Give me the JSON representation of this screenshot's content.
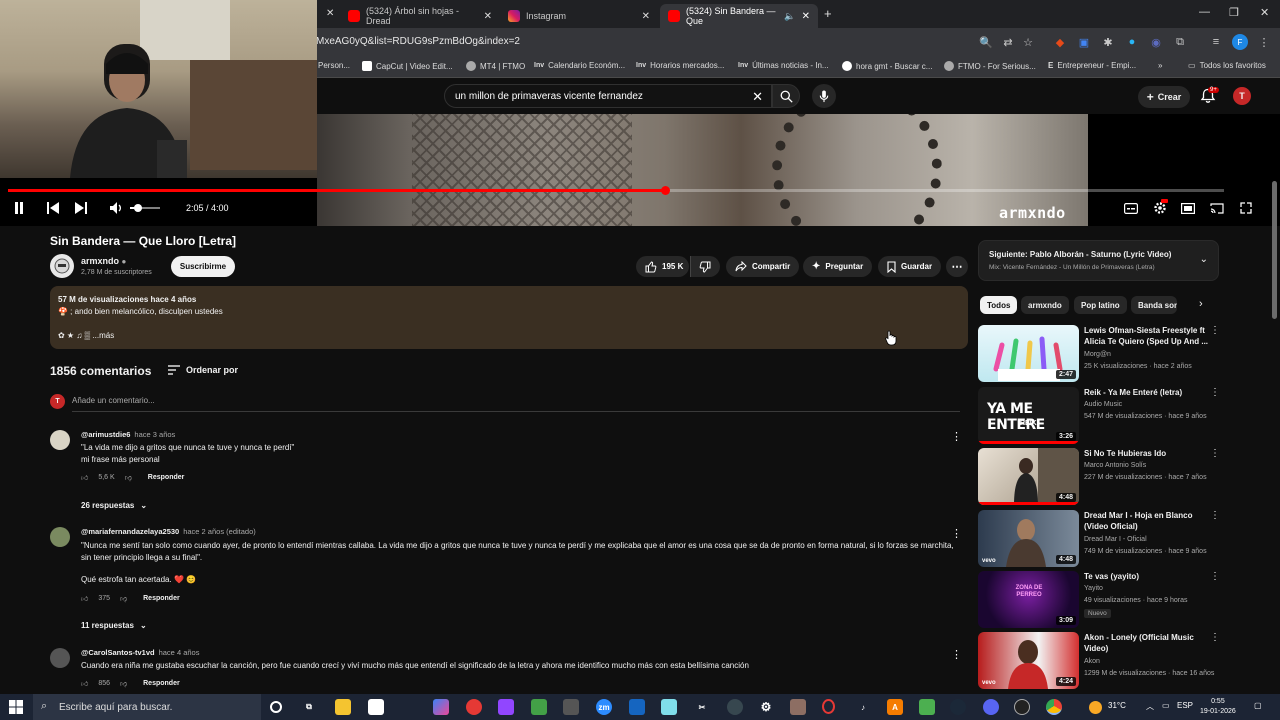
{
  "browser": {
    "tabs": [
      {
        "label": "(5324) Árbol sin hojas - Dread",
        "active": false
      },
      {
        "label": "Instagram",
        "active": false
      },
      {
        "label": "(5324) Sin Bandera — Que",
        "active": true
      }
    ],
    "url": "MxeAG0yQ&list=RDUG9sPzmBdOg&index=2",
    "bookmarks": [
      "Person...",
      "CapCut | Video Edit...",
      "MT4 | FTMO",
      "Calendario Económ...",
      "Horarios mercados...",
      "Últimas noticias - In...",
      "hora gmt - Buscar c...",
      "FTMO - For Serious...",
      "Entrepreneur - Empi..."
    ],
    "all_favorites": "Todos los favoritos"
  },
  "youtube": {
    "search_query": "un millon de primaveras vicente fernandez",
    "create_label": "Crear",
    "notif_count": "9+",
    "user_initial": "T"
  },
  "player": {
    "time": "2:05 / 4:00",
    "progress": 0.54,
    "volume": 0.25,
    "watermark": "armxndo"
  },
  "video": {
    "title": "Sin Bandera — Que Lloro [Letra]",
    "channel": "armxndo",
    "subscribers": "2,78 M de suscriptores",
    "subscribe_label": "Suscribirme",
    "likes": "195 K",
    "share_label": "Compartir",
    "ask_label": "Preguntar",
    "save_label": "Guardar",
    "desc_meta": "57 M de visualizaciones  hace 4 años",
    "desc_line": "🍄 ; ando bien melancólico, disculpen ustedes",
    "desc_more": "✿ ★ ♫ ▒  ...más"
  },
  "comments": {
    "count": "1856 comentarios",
    "sort_label": "Ordenar por",
    "add_placeholder": "Añade un comentario...",
    "items": [
      {
        "author": "@arimustdie6",
        "time": "hace 3 años",
        "text": "\"La vida me dijo a gritos que nunca te tuve y nunca te perdí\"",
        "text2": "mi frase más personal",
        "likes": "5,6 K",
        "reply": "Responder",
        "replies": "26 respuestas"
      },
      {
        "author": "@mariafernandazelaya2530",
        "time": "hace 2 años (editado)",
        "text": "\"Nunca me sentí tan solo como cuando ayer, de pronto lo entendí mientras callaba. La vida me dijo a gritos que nunca te tuve y nunca te perdí y me explicaba que el amor es una cosa que se da de pronto en forma natural, si lo forzas se marchita, sin tener principio llega a su final\".",
        "text2": "Qué estrofa tan acertada. ❤️ 😊",
        "likes": "375",
        "reply": "Responder",
        "replies": "11 respuestas"
      },
      {
        "author": "@CarolSantos-tv1vd",
        "time": "hace 4 años",
        "text": "Cuando era niña me gustaba escuchar la canción, pero fue cuando crecí y viví mucho más que entendí el significado de la letra y ahora me identifico mucho más con esta bellísima canción",
        "likes": "856",
        "reply": "Responder"
      }
    ]
  },
  "sidebar": {
    "next_title": "Siguiente: Pablo Alborán - Saturno (Lyric Video)",
    "next_sub": "Mix: Vicente Fernández - Un Millón de Primaveras (Letra)",
    "chips": [
      "Todos",
      "armxndo",
      "Pop latino",
      "Banda sonora"
    ],
    "recs": [
      {
        "title": "Lewis Ofman-Siesta Freestyle ft Alicia Te Quiero (Sped Up And ...",
        "channel": "Morg@n",
        "meta": "25 K visualizaciones · hace 2 años",
        "duration": "2:47"
      },
      {
        "title": "Reik - Ya Me Enteré (letra)",
        "channel": "Audio Music",
        "meta": "547 M de visualizaciones · hace 9 años",
        "duration": "3:26",
        "thumb_text": "YA ME ENTERE",
        "thumb_sub": "REIK"
      },
      {
        "title": "Si No Te Hubieras Ido",
        "channel": "Marco Antonio Solís",
        "meta": "227 M de visualizaciones · hace 7 años",
        "duration": "4:48"
      },
      {
        "title": "Dread Mar I - Hoja en Blanco (Video Oficial)",
        "channel": "Dread Mar I - Oficial",
        "meta": "749 M de visualizaciones · hace 9 años",
        "duration": "4:48"
      },
      {
        "title": "Te vas (yayito)",
        "channel": "Yayito",
        "meta": "49 visualizaciones · hace 9 horas",
        "badge": "Nuevo",
        "duration": "3:09",
        "thumb_text": "ZONA DE PERREO"
      },
      {
        "title": "Akon - Lonely (Official Music Video)",
        "channel": "Akon",
        "meta": "1299 M de visualizaciones · hace 16 años",
        "duration": "4:24"
      }
    ]
  },
  "taskbar": {
    "search_placeholder": "Escribe aquí para buscar.",
    "temp": "31°C",
    "lang": "ESP",
    "time": "0:55",
    "date": "19-01-2026"
  }
}
